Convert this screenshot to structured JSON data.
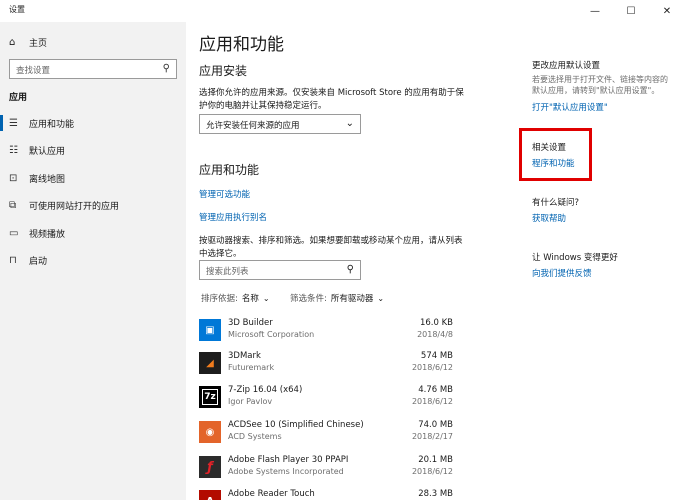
{
  "window": {
    "title": "设置",
    "controls": {
      "minimize": "—",
      "maximize": "☐",
      "close": "✕"
    }
  },
  "sidebar": {
    "home": "主页",
    "search_placeholder": "查找设置",
    "section": "应用",
    "items": [
      {
        "label": "应用和功能",
        "icon": "apps-list-icon",
        "active": true
      },
      {
        "label": "默认应用",
        "icon": "default-apps-icon",
        "active": false
      },
      {
        "label": "离线地图",
        "icon": "offline-maps-icon",
        "active": false
      },
      {
        "label": "可使用网站打开的应用",
        "icon": "websites-apps-icon",
        "active": false
      },
      {
        "label": "视频播放",
        "icon": "video-icon",
        "active": false
      },
      {
        "label": "启动",
        "icon": "startup-icon",
        "active": false
      }
    ]
  },
  "main": {
    "title": "应用和功能",
    "install": {
      "heading": "应用安装",
      "description": "选择你允许的应用来源。仅安装来自 Microsoft Store 的应用有助于保护你的电脑并让其保持稳定运行。",
      "dropdown_value": "允许安装任何来源的应用"
    },
    "apps": {
      "heading": "应用和功能",
      "link_optional": "管理可选功能",
      "link_aliases": "管理应用执行别名",
      "description": "按驱动器搜索、排序和筛选。如果想要卸载或移动某个应用，请从列表中选择它。",
      "search_placeholder": "搜索此列表",
      "sort_label": "排序依据:",
      "sort_value": "名称",
      "filter_label": "筛选条件:",
      "filter_value": "所有驱动器"
    },
    "app_list": [
      {
        "name": "3D Builder",
        "publisher": "Microsoft Corporation",
        "size": "16.0 KB",
        "date": "2018/4/8",
        "icon_color": "#0078d7",
        "icon_glyph": "▣"
      },
      {
        "name": "3DMark",
        "publisher": "Futuremark",
        "size": "574 MB",
        "date": "2018/6/12",
        "icon_color": "#1d1d1d",
        "icon_glyph": "◢"
      },
      {
        "name": "7-Zip 16.04 (x64)",
        "publisher": "Igor Pavlov",
        "size": "4.76 MB",
        "date": "2018/6/12",
        "icon_color": "#000000",
        "icon_glyph": "7z"
      },
      {
        "name": "ACDSee 10 (Simplified Chinese)",
        "publisher": "ACD Systems",
        "size": "74.0 MB",
        "date": "2018/2/17",
        "icon_color": "#e3642a",
        "icon_glyph": "◉"
      },
      {
        "name": "Adobe Flash Player 30 PPAPI",
        "publisher": "Adobe Systems Incorporated",
        "size": "20.1 MB",
        "date": "2018/6/12",
        "icon_color": "#2b2b2b",
        "icon_glyph": "ƒ"
      },
      {
        "name": "Adobe Reader Touch",
        "publisher": "",
        "size": "28.3 MB",
        "date": "",
        "icon_color": "#b30b00",
        "icon_glyph": "A"
      }
    ]
  },
  "right": {
    "default_settings_heading": "更改应用默认设置",
    "default_settings_text": "若要选择用于打开文件、链接等内容的默认应用，请转到\"默认应用设置\"。",
    "default_settings_link": "打开\"默认应用设置\"",
    "related_heading": "相关设置",
    "related_link": "程序和功能",
    "question_heading": "有什么疑问?",
    "help_link": "获取帮助",
    "improve_heading": "让 Windows 变得更好",
    "feedback_link": "向我们提供反馈",
    "highlight_color": "#e00000"
  }
}
